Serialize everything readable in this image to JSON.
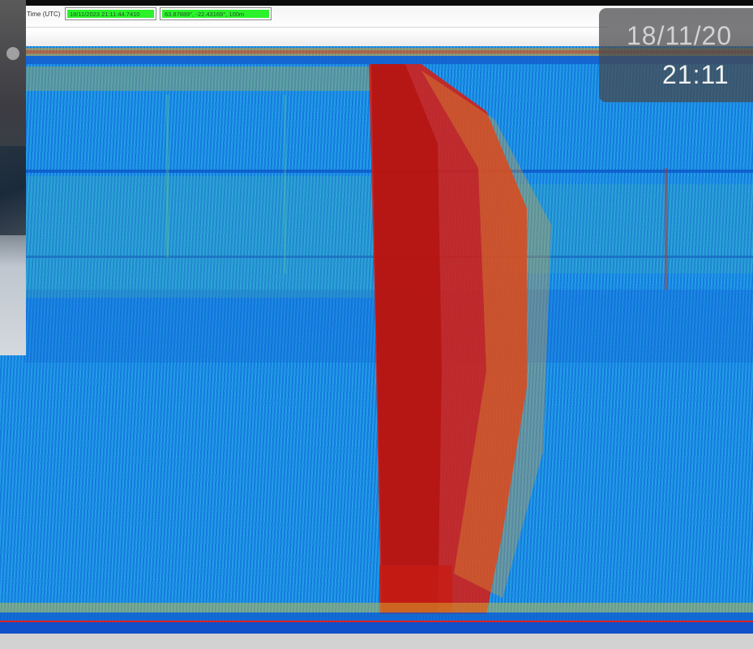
{
  "toolbar": {
    "time_label": "Time (UTC)",
    "utc_time_value": "18/11/2023 21:11:44.7410",
    "position_value": "63.87889°, -22.43169°, 100m"
  },
  "overlay": {
    "date": "18/11/20",
    "time": "21:11"
  },
  "colors": {
    "background_blue": "#1c8fe6",
    "signal_red": "#e21a12",
    "field_green": "#2cf22c",
    "marker_line_red": "#e02020"
  },
  "icons": {
    "camera_inset": "video-feed-inset"
  }
}
